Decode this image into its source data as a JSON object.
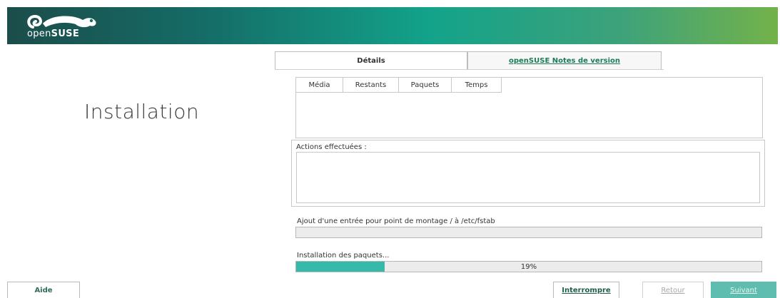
{
  "header": {
    "brand_prefix": "open",
    "brand_name": "SUSE"
  },
  "page": {
    "title": "Installation"
  },
  "tabs": [
    {
      "label": "Détails",
      "active": true
    },
    {
      "label": "openSUSE Notes de version",
      "active": false
    }
  ],
  "media_table": {
    "columns": [
      "Média",
      "Restants",
      "Paquets",
      "Temps"
    ]
  },
  "actions": {
    "label": "Actions effectuées :"
  },
  "current_step": {
    "label": "Ajout d'une entrée pour point de montage / à /etc/fstab",
    "progress": 0
  },
  "package_install": {
    "label": "Installation des paquets...",
    "progress": 19,
    "progress_text": "19%"
  },
  "buttons": {
    "help": "Aide",
    "abort": "Interrompre",
    "back": "Retour",
    "next": "Suivant"
  },
  "colors": {
    "accent": "#35b9ab",
    "next_button": "#5fbdb0",
    "header_start": "#1b4d4a",
    "header_end": "#73b24a"
  }
}
